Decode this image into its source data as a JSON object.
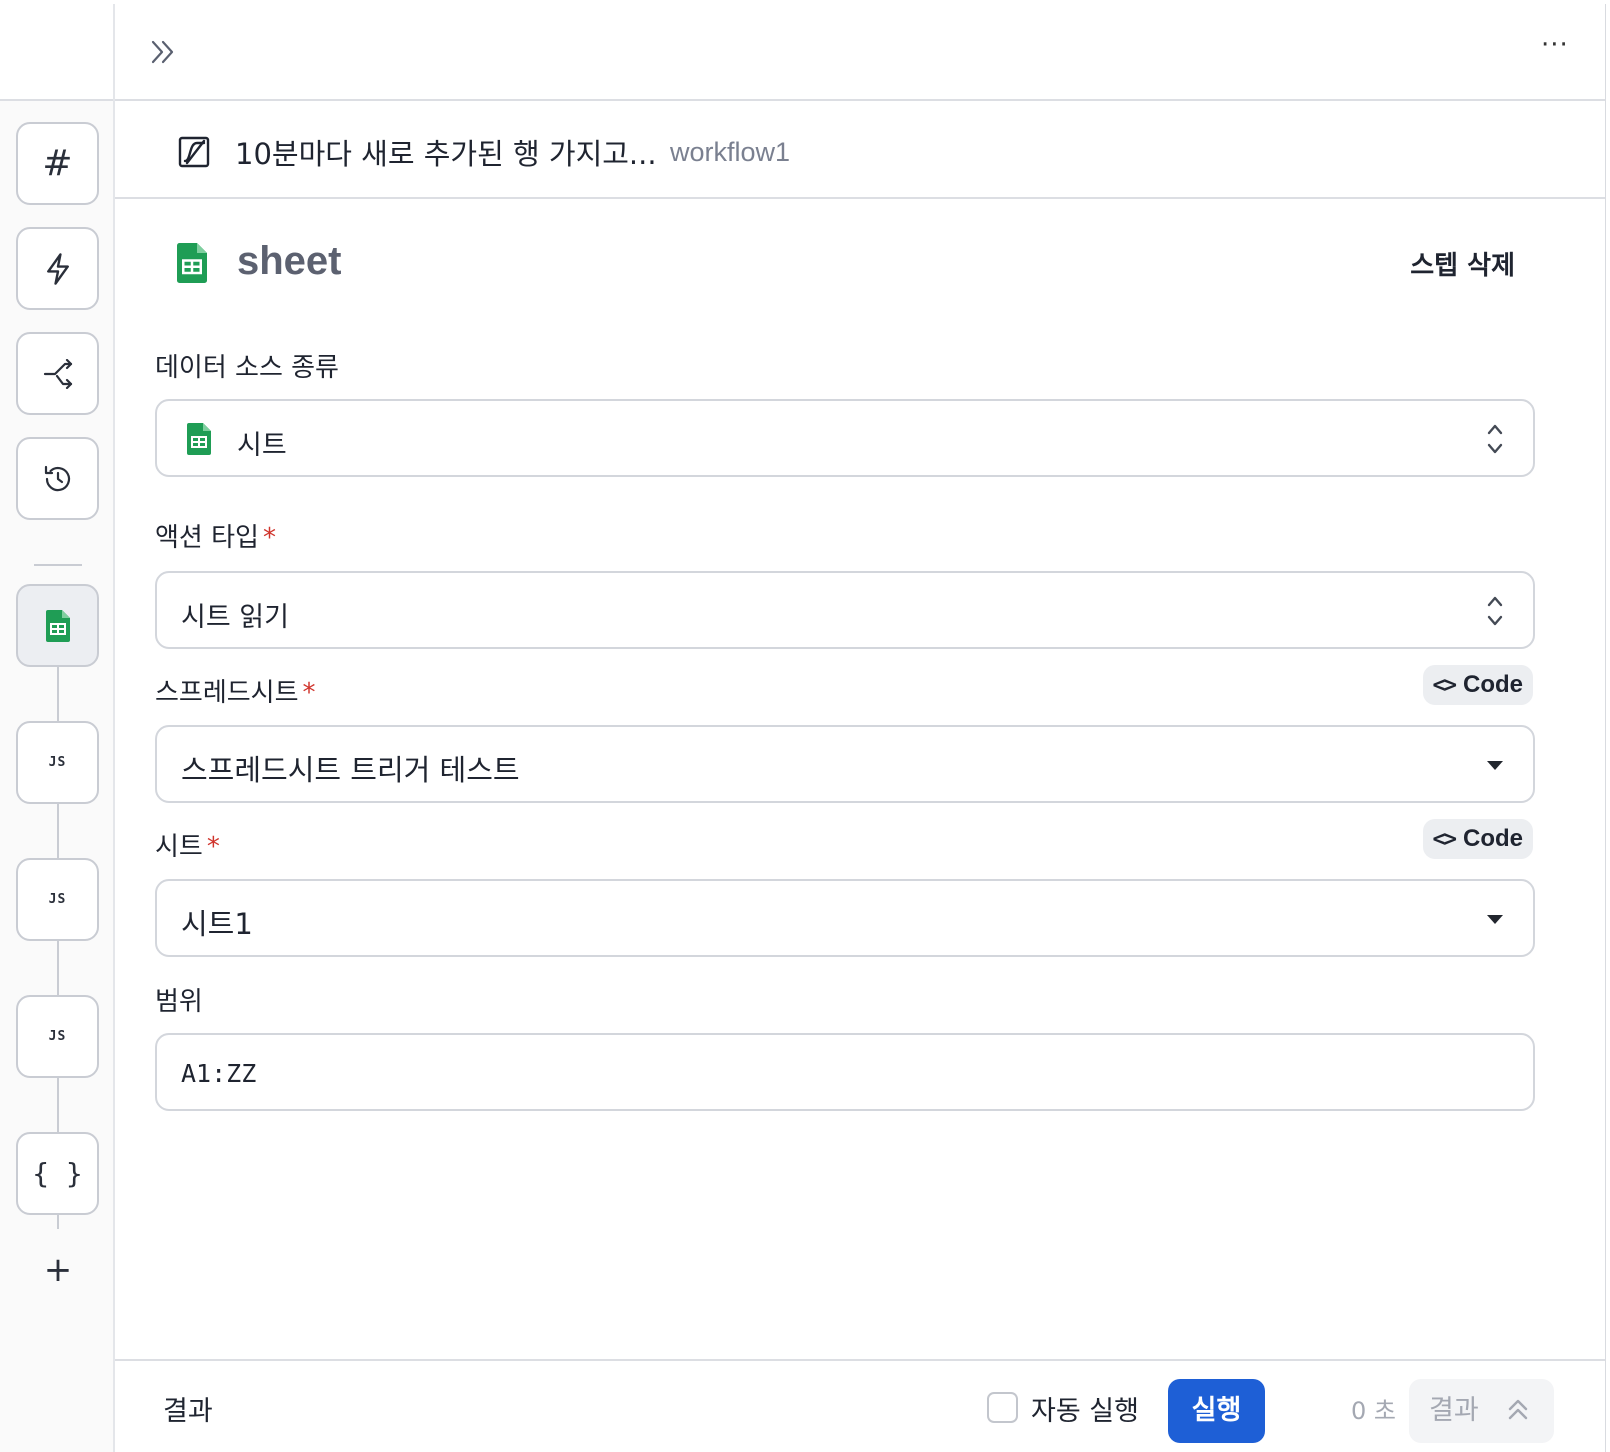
{
  "topbar": {
    "expand_icon": "double-chevron-right-icon",
    "more_label": "···"
  },
  "workflow": {
    "title": "10분마다 새로 추가된 행 가지고...",
    "subtitle": "workflow1"
  },
  "rail": {
    "items": [
      {
        "name": "hash",
        "symbol": "#"
      },
      {
        "name": "trigger",
        "icon": "bolt-icon"
      },
      {
        "name": "branch",
        "icon": "shuffle-icon"
      },
      {
        "name": "history",
        "icon": "history-icon"
      },
      {
        "name": "sheet-step",
        "icon": "google-sheets-icon"
      },
      {
        "name": "js-step-1",
        "symbol": "JS"
      },
      {
        "name": "js-step-2",
        "symbol": "JS"
      },
      {
        "name": "js-step-3",
        "symbol": "JS"
      },
      {
        "name": "json-step",
        "symbol": "{ }"
      }
    ],
    "add_symbol": "+"
  },
  "step": {
    "name": "sheet",
    "delete_label": "스텝 삭제"
  },
  "form": {
    "data_source": {
      "label": "데이터 소스 종류",
      "value": "시트"
    },
    "action_type": {
      "label": "액션 타입",
      "required": "*",
      "value": "시트 읽기"
    },
    "spreadsheet": {
      "label": "스프레드시트",
      "required": "*",
      "value": "스프레드시트 트리거 테스트",
      "code_label": "Code",
      "code_icon": "<>"
    },
    "sheet": {
      "label": "시트",
      "required": "*",
      "value": "시트1",
      "code_label": "Code",
      "code_icon": "<>"
    },
    "range": {
      "label": "범위",
      "value": "A1:ZZ"
    }
  },
  "footer": {
    "result_label": "결과",
    "auto_run_label": "자동 실행",
    "auto_run_checked": false,
    "run_label": "실행",
    "time_label": "0 초",
    "result_toggle_label": "결과"
  },
  "colors": {
    "primary": "#1e5fd6",
    "required": "#d0342c",
    "sheets_green": "#1f9d55"
  }
}
